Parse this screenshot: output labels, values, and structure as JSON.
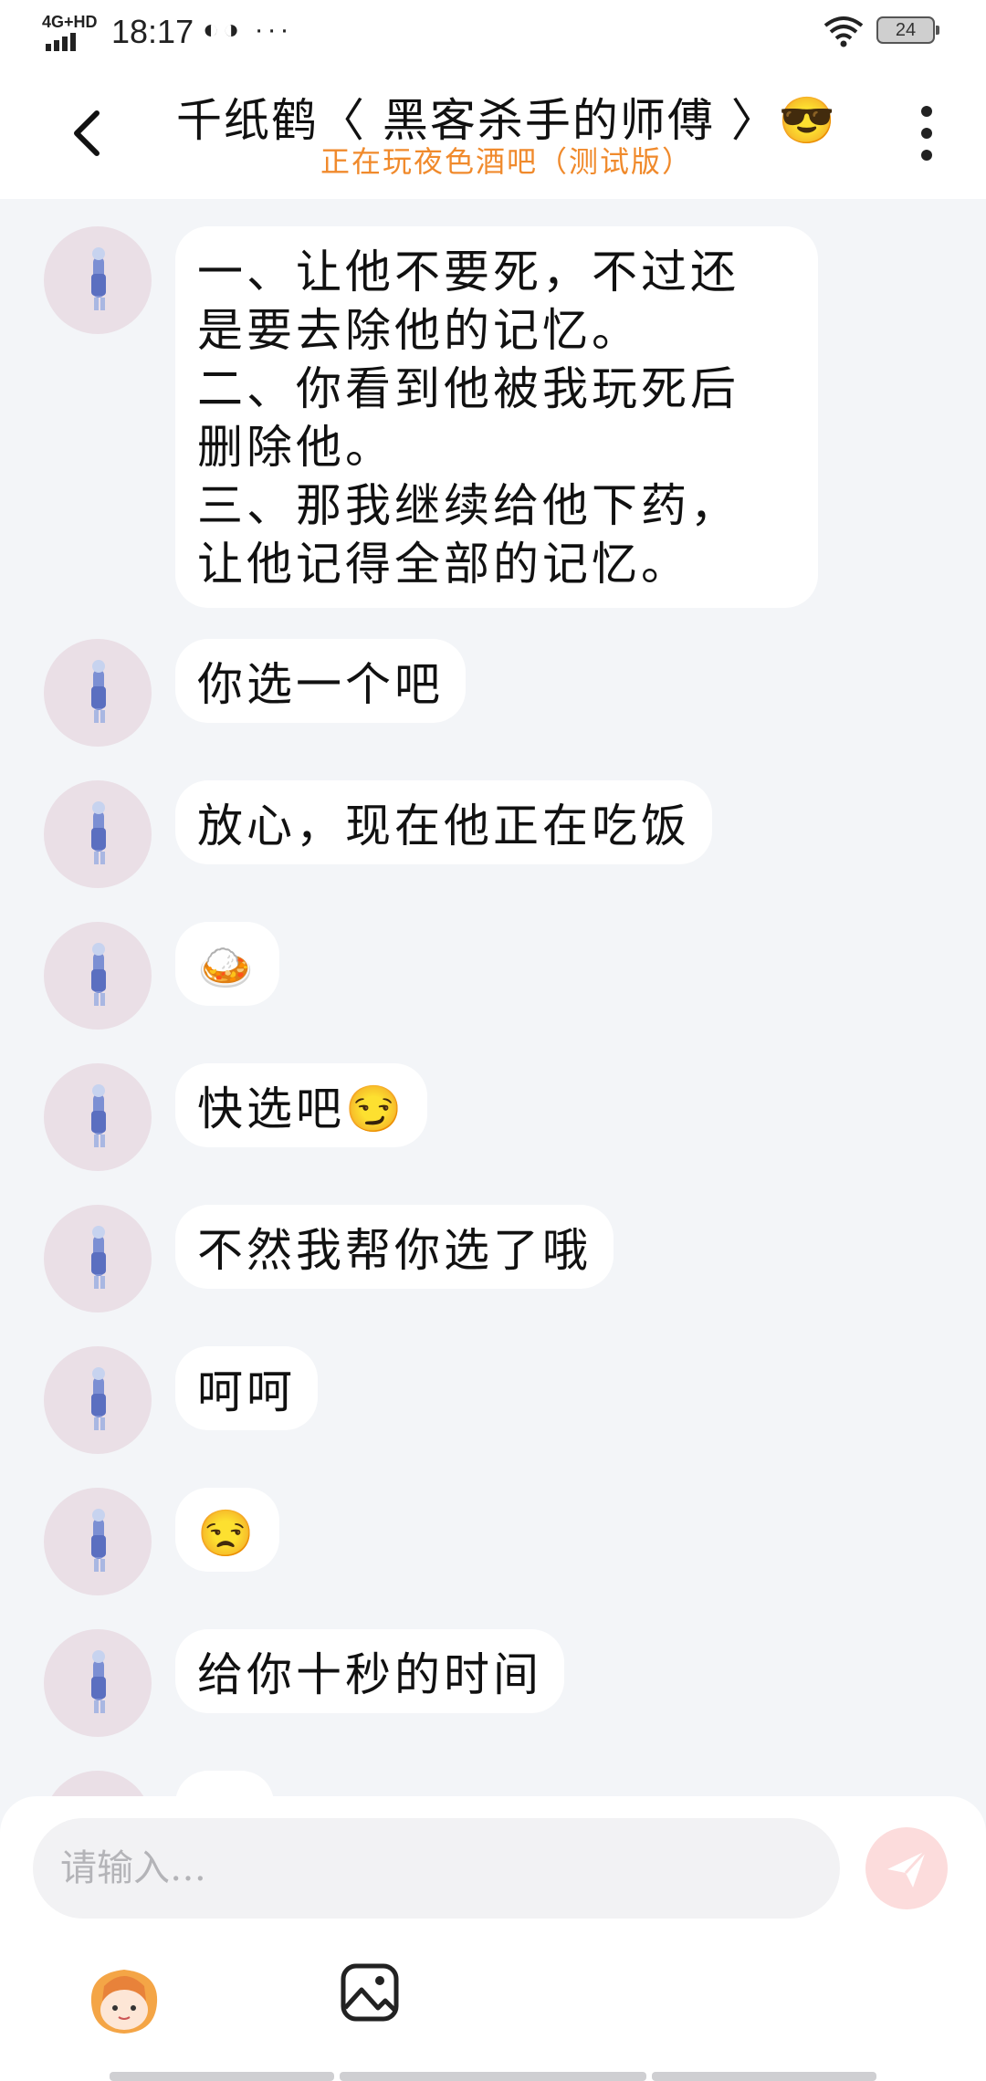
{
  "status_bar": {
    "network": "4G+HD",
    "time": "18:17",
    "notification_icons": "◐◑ ···",
    "battery": "24"
  },
  "header": {
    "title": "千纸鹤〈 黑客杀手的师傅 〉😎",
    "subtitle": "正在玩夜色酒吧（测试版）",
    "accent_color": "#f08a2c"
  },
  "messages": [
    {
      "text": "一、让他不要死，不过还\n是要去除他的记忆。\n二、你看到他被我玩死后\n删除他。\n三、那我继续给他下药，\n让他记得全部的记忆。"
    },
    {
      "text": "你选一个吧"
    },
    {
      "text": "放心，现在他正在吃饭"
    },
    {
      "text": "🍛"
    },
    {
      "text": "快选吧😏"
    },
    {
      "text": "不然我帮你选了哦"
    },
    {
      "text": "呵呵"
    },
    {
      "text": "😒"
    },
    {
      "text": "给你十秒的时间"
    },
    {
      "text": ""
    }
  ],
  "input": {
    "placeholder": "请输入…"
  },
  "icons": {
    "back": "chevron-left-icon",
    "more": "more-vertical-icon",
    "send": "send-icon",
    "sticker": "sticker-icon",
    "image": "image-icon"
  }
}
